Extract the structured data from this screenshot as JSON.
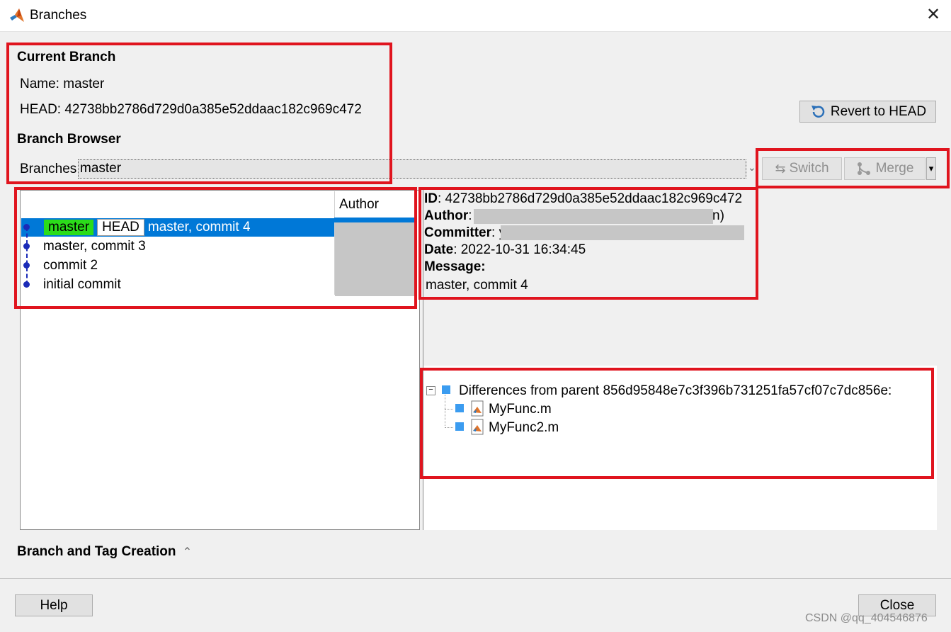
{
  "window": {
    "title": "Branches",
    "close_glyph": "✕"
  },
  "current_branch": {
    "heading": "Current Branch",
    "name_text": "Name: master",
    "head_text": "HEAD: 42738bb2786d729d0a385e52ddaac182c969c472"
  },
  "browser": {
    "heading": "Branch Browser",
    "branches_label": "Branches:",
    "branches_value": "master"
  },
  "toolbar": {
    "revert_label": "Revert to HEAD",
    "switch_label": "Switch",
    "merge_label": "Merge",
    "dropdown_glyph": "▾"
  },
  "commits": {
    "author_header": "Author",
    "rows": [
      {
        "tags": [
          "master",
          "HEAD"
        ],
        "message": "master, commit 4",
        "selected": true
      },
      {
        "tags": [],
        "message": "master, commit 3",
        "selected": false
      },
      {
        "tags": [],
        "message": "commit 2",
        "selected": false
      },
      {
        "tags": [],
        "message": "initial commit",
        "selected": false
      }
    ]
  },
  "details": {
    "id_label": "ID",
    "id_value": ": 42738bb2786d729d0a385e52ddaac182c969c472",
    "author_label": "Author",
    "author_prefix": ":",
    "author_suffix": "n)",
    "committer_label": "Committer",
    "committer_prefix": ": y",
    "date_label": "Date",
    "date_value": ": 2022-10-31 16:34:45",
    "message_label": "Message:",
    "message_value": "master, commit 4"
  },
  "differences": {
    "header": "Differences from parent 856d95848e7c3f396b731251fa57cf07c7dc856e:",
    "files": [
      "MyFunc.m",
      "MyFunc2.m"
    ]
  },
  "creation": {
    "label": "Branch and Tag Creation",
    "chevron": "⌃"
  },
  "footer": {
    "help_label": "Help",
    "close_label": "Close"
  },
  "watermark": "CSDN @qq_404546876",
  "colors": {
    "selection": "#0078d7",
    "head_tag": "#2bdc1a",
    "highlight_box": "#e0141e",
    "graph_dot": "#1b2bb8"
  }
}
